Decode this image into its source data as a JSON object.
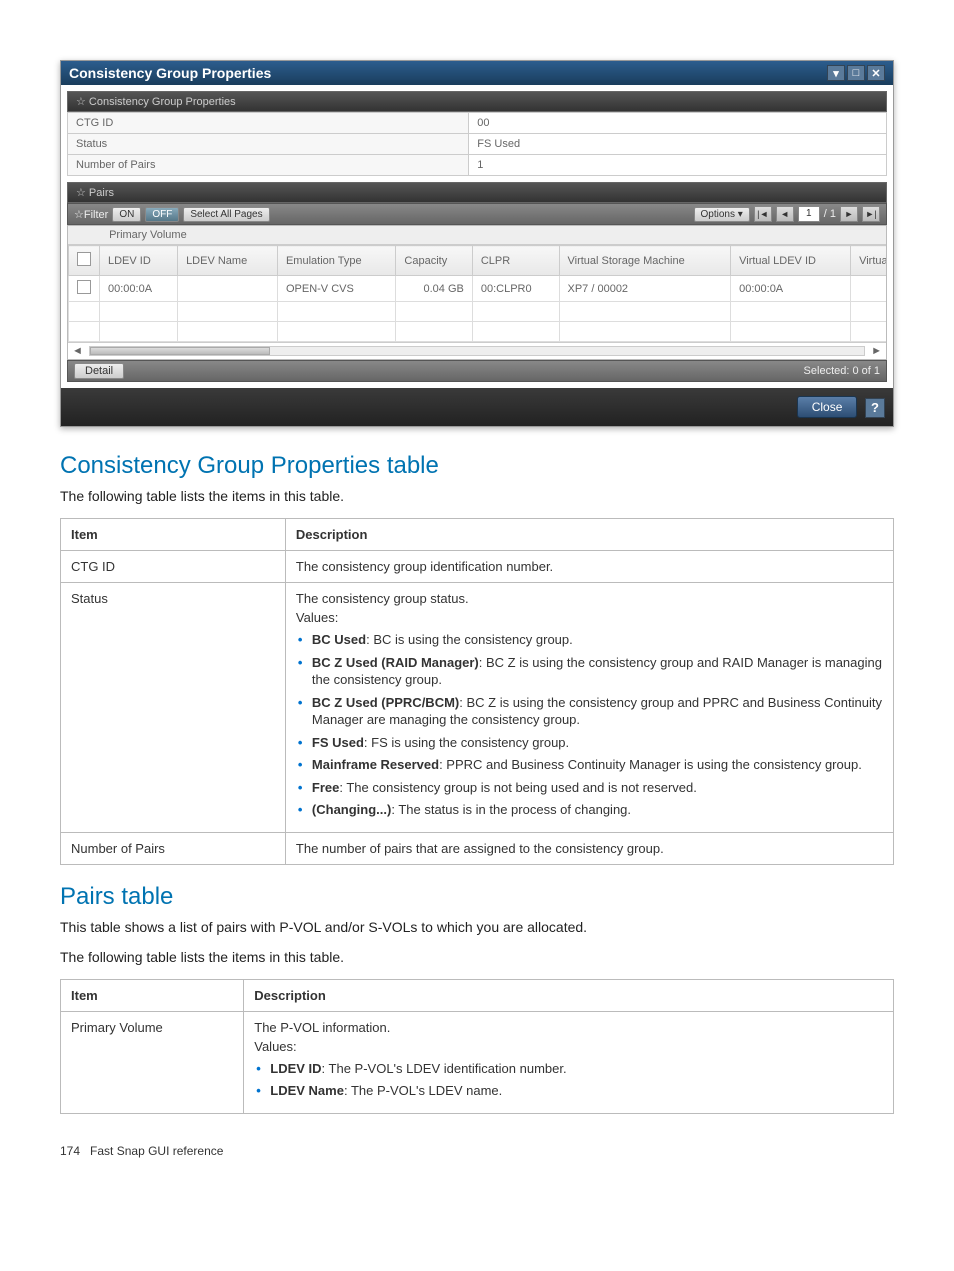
{
  "dialog": {
    "title": "Consistency Group Properties",
    "section_header": "☆ Consistency Group Properties",
    "kv": {
      "labels": {
        "ctg_id": "CTG ID",
        "status": "Status",
        "num_pairs": "Number of Pairs"
      },
      "values": {
        "ctg_id": "00",
        "status": "FS Used",
        "num_pairs": "1"
      }
    },
    "pairs_header": "☆ Pairs",
    "toolbar": {
      "filter_label": "☆Filter",
      "on": "ON",
      "off": "OFF",
      "select_all_pages": "Select All Pages",
      "options": "Options ▾",
      "page_current": "1",
      "page_sep": "/ 1"
    },
    "grid": {
      "group_header": "Primary Volume",
      "columns": [
        "LDEV ID",
        "LDEV Name",
        "Emulation Type",
        "Capacity",
        "CLPR",
        "Virtual Storage Machine",
        "Virtual LDEV ID",
        "Virtual D Name"
      ],
      "rows": [
        {
          "ldev_id": "00:00:0A",
          "ldev_name": "",
          "emulation": "OPEN-V CVS",
          "capacity": "0.04 GB",
          "clpr": "00:CLPR0",
          "vsm": "XP7 / 00002",
          "vldev": "00:00:0A",
          "vdname": ""
        }
      ]
    },
    "footer": {
      "detail": "Detail",
      "selected_label": "Selected:  0   of   1"
    },
    "close": "Close",
    "help": "?"
  },
  "doc": {
    "h1": "Consistency Group Properties table",
    "p1": "The following table lists the items in this table.",
    "table1": {
      "head_item": "Item",
      "head_desc": "Description",
      "rows": [
        {
          "item": "CTG ID",
          "desc_text": "The consistency group identification number."
        },
        {
          "item": "Status",
          "desc_intro": "The consistency group status.",
          "desc_values_label": "Values:",
          "values": [
            {
              "bold": "BC Used",
              "rest": ": BC is using the consistency group."
            },
            {
              "bold": "BC Z Used (RAID Manager)",
              "rest": ": BC Z is using the consistency group and RAID Manager is managing the consistency group."
            },
            {
              "bold": "BC Z Used (PPRC/BCM)",
              "rest": ": BC Z is using the consistency group and PPRC and Business Continuity Manager are managing the consistency group."
            },
            {
              "bold": "FS Used",
              "rest": ": FS is using the consistency group."
            },
            {
              "bold": "Mainframe Reserved",
              "rest": ": PPRC and Business Continuity Manager is using the consistency group."
            },
            {
              "bold": "Free",
              "rest": ": The consistency group is not being used and is not reserved."
            },
            {
              "bold": "(Changing...)",
              "rest": ": The status is in the process of changing."
            }
          ]
        },
        {
          "item": "Number of Pairs",
          "desc_text": "The number of pairs that are assigned to the consistency group."
        }
      ]
    },
    "h2": "Pairs table",
    "p2a": "This table shows a list of pairs with P-VOL and/or S-VOLs to which you are allocated.",
    "p2b": "The following table lists the items in this table.",
    "table2": {
      "head_item": "Item",
      "head_desc": "Description",
      "row": {
        "item": "Primary Volume",
        "desc_intro": "The P-VOL information.",
        "desc_values_label": "Values:",
        "values": [
          {
            "bold": "LDEV ID",
            "rest": ": The P-VOL's LDEV identification number."
          },
          {
            "bold": "LDEV Name",
            "rest": ": The P-VOL's LDEV name."
          }
        ]
      }
    },
    "footer_page": "174",
    "footer_text": "Fast Snap GUI reference"
  }
}
